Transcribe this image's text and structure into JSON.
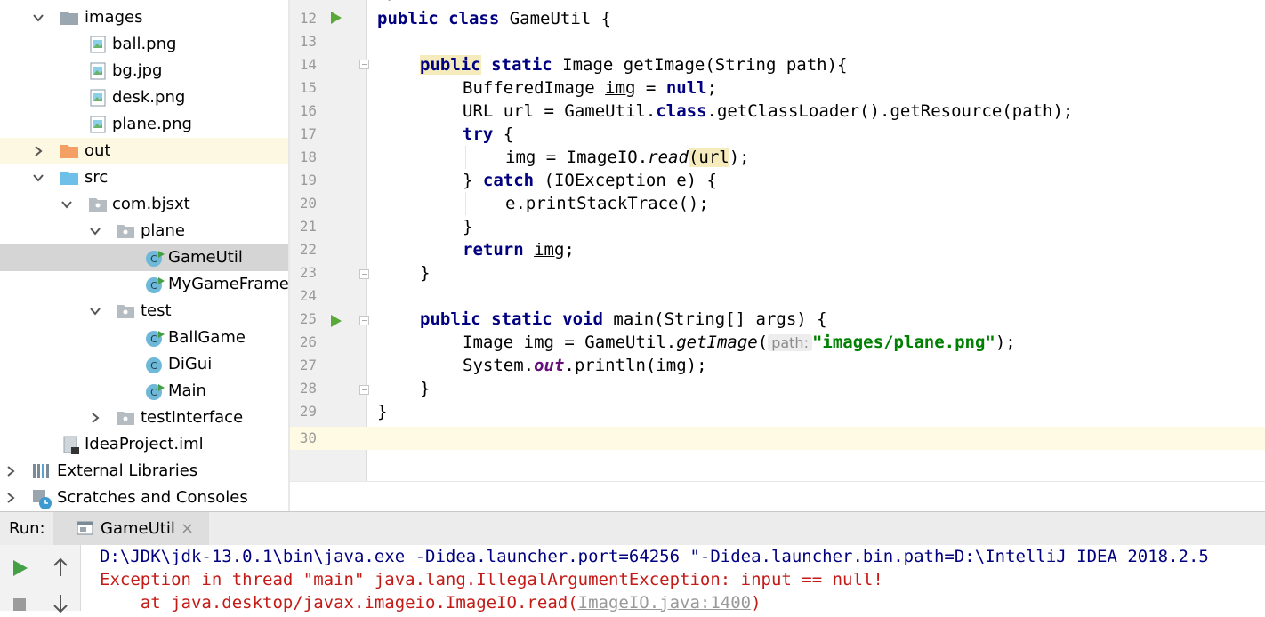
{
  "project_tree": {
    "images_folder": "images",
    "files_images": [
      "ball.png",
      "bg.jpg",
      "desk.png",
      "plane.png"
    ],
    "out_folder": "out",
    "src_folder": "src",
    "package_root": "com.bjsxt",
    "package_plane": "plane",
    "class_gameutil": "GameUtil",
    "class_mygameframe": "MyGameFrame",
    "package_test": "test",
    "test_classes": [
      "BallGame",
      "DiGui",
      "Main"
    ],
    "package_testinterface": "testInterface",
    "iml_file": "IdeaProject.iml",
    "external_libraries": "External Libraries",
    "scratches": "Scratches and Consoles"
  },
  "editor": {
    "line_numbers": [
      "12",
      "13",
      "14",
      "15",
      "16",
      "17",
      "18",
      "19",
      "20",
      "21",
      "22",
      "23",
      "24",
      "25",
      "26",
      "27",
      "28",
      "29",
      "30"
    ],
    "l12_kw1": "public",
    "l12_kw2": "class",
    "l12_rest": " GameUtil {",
    "l14_kw1": "public",
    "l14_kw2": "static",
    "l14_rest": " Image getImage(String path){",
    "l15_a": "BufferedImage ",
    "l15_var": "img",
    "l15_b": " = ",
    "l15_kw": "null",
    "l15_c": ";",
    "l16_a": "URL url = GameUtil.",
    "l16_kw": "class",
    "l16_b": ".getClassLoader().getResource(path);",
    "l17_kw": "try",
    "l17_b": " {",
    "l18_var": "img",
    "l18_a": " = ImageIO.",
    "l18_m": "read",
    "l18_p1": "(",
    "l18_arg": "url",
    "l18_p2": ");",
    "l19_a": "} ",
    "l19_kw": "catch",
    "l19_b": " (IOException e) {",
    "l20": "e.printStackTrace();",
    "l21": "}",
    "l22_kw": "return",
    "l22_sp": " ",
    "l22_var": "img",
    "l22_end": ";",
    "l23": "}",
    "l25_kw1": "public",
    "l25_kw2": "static",
    "l25_kw3": "void",
    "l25_rest": " main(String[] args) {",
    "l26_a": "Image img = GameUtil.",
    "l26_m": "getImage",
    "l26_p": "(",
    "l26_hint": "path:",
    "l26_str": "\"images/plane.png\"",
    "l26_end": ");",
    "l27_a": "System.",
    "l27_field": "out",
    "l27_b": ".println(img);",
    "l28": "}",
    "l29": "}"
  },
  "run_panel": {
    "label": "Run:",
    "tab_label": "GameUtil",
    "tab_close": "×",
    "console_lines": [
      "D:\\JDK\\jdk-13.0.1\\bin\\java.exe -Didea.launcher.port=64256 \"-Didea.launcher.bin.path=D:\\IntelliJ IDEA 2018.2.5",
      "Exception in thread \"main\" java.lang.IllegalArgumentException: input == null!",
      "    at java.desktop/javax.imageio.ImageIO.read("
    ],
    "console_link": "ImageIO.java:1400",
    "console_link_end": ")"
  },
  "colors": {
    "keyword": "#000080",
    "string": "#008000",
    "static_field": "#660e7a",
    "error_text": "#c41a16",
    "run_green": "#5aa839",
    "current_line": "#fefae3",
    "selected_row": "#d5d5d5"
  },
  "icons": {
    "folder": "folder-icon",
    "image_file": "image-file-icon",
    "package": "package-icon",
    "java_class_runnable": "java-class-run-icon",
    "java_class": "java-class-icon",
    "module_file": "iml-file-icon",
    "libraries": "libraries-icon",
    "scratches": "scratches-icon",
    "run": "run-icon",
    "stop": "stop-icon",
    "up": "arrow-up-icon",
    "down": "arrow-down-icon"
  }
}
